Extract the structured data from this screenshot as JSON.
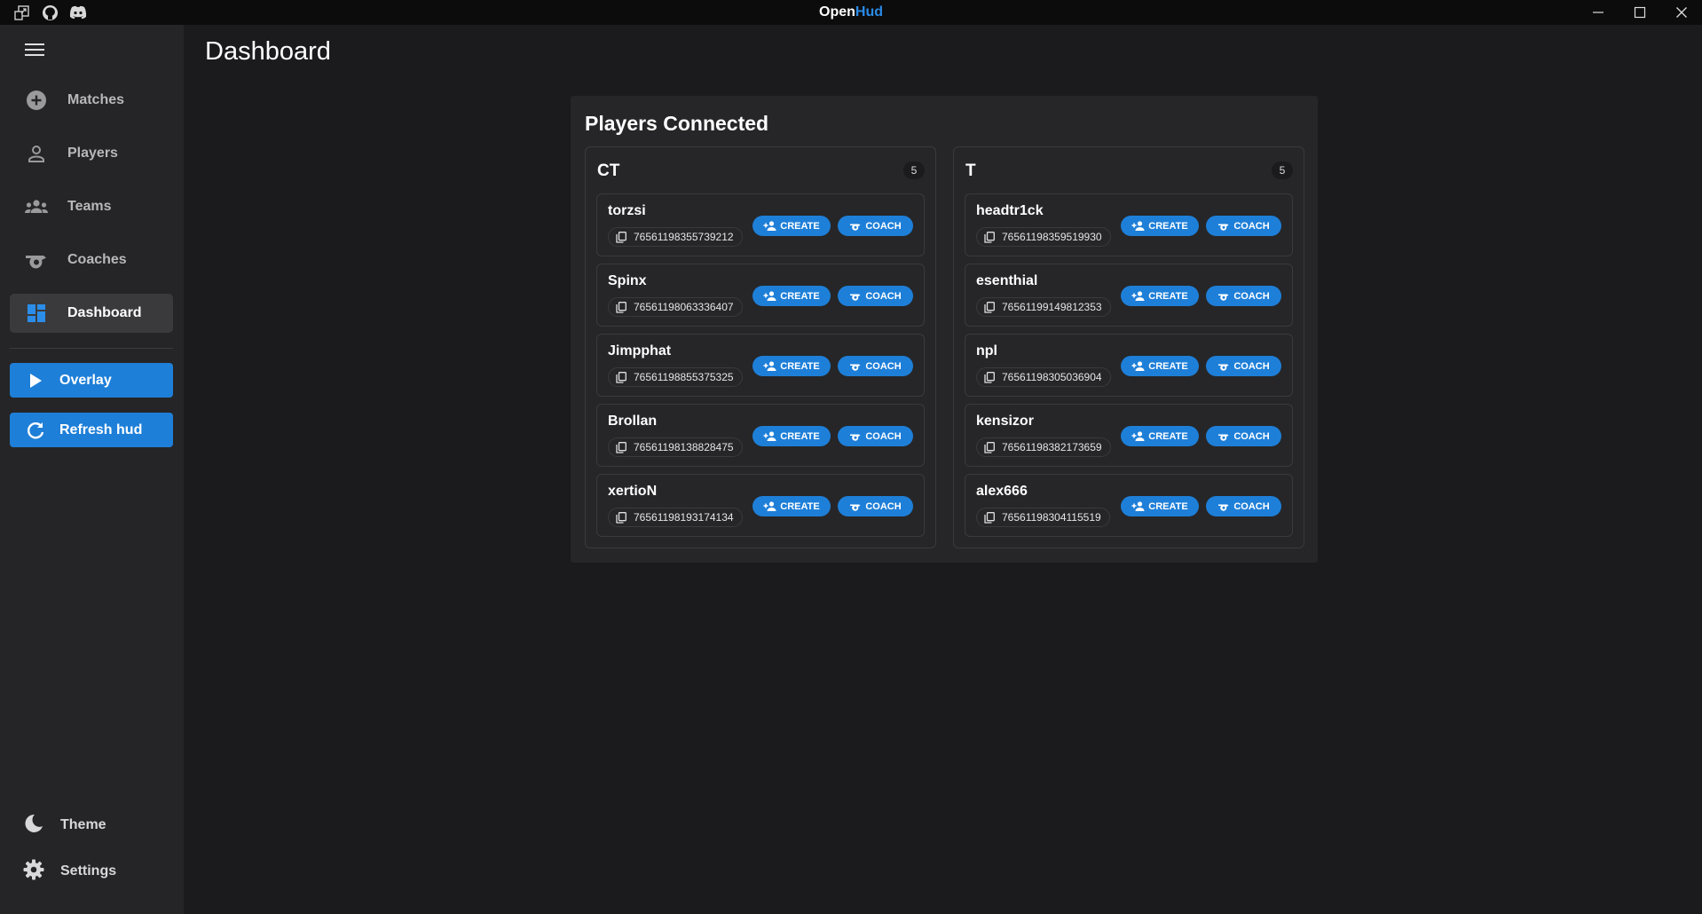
{
  "titlebar": {
    "title_main": "Open",
    "title_accent": "Hud",
    "icons": [
      "external-window-icon",
      "github-icon",
      "discord-icon"
    ],
    "controls": [
      "minimize-icon",
      "maximize-icon",
      "close-icon"
    ]
  },
  "sidebar": {
    "items": [
      {
        "label": "Matches",
        "icon": "plus-circle-icon"
      },
      {
        "label": "Players",
        "icon": "person-icon"
      },
      {
        "label": "Teams",
        "icon": "group-icon"
      },
      {
        "label": "Coaches",
        "icon": "whistle-icon"
      },
      {
        "label": "Dashboard",
        "icon": "dashboard-icon",
        "active": true
      }
    ],
    "overlay_label": "Overlay",
    "refresh_label": "Refresh hud",
    "theme_label": "Theme",
    "settings_label": "Settings"
  },
  "main": {
    "page_title": "Dashboard",
    "panel_title": "Players Connected",
    "create_label": "CREATE",
    "coach_label": "COACH",
    "teams": [
      {
        "name": "CT",
        "count": "5",
        "players": [
          {
            "name": "torzsi",
            "steamid": "76561198355739212"
          },
          {
            "name": "Spinx",
            "steamid": "76561198063336407"
          },
          {
            "name": "Jimpphat",
            "steamid": "76561198855375325"
          },
          {
            "name": "Brollan",
            "steamid": "76561198138828475"
          },
          {
            "name": "xertioN",
            "steamid": "76561198193174134"
          }
        ]
      },
      {
        "name": "T",
        "count": "5",
        "players": [
          {
            "name": "headtr1ck",
            "steamid": "76561198359519930"
          },
          {
            "name": "esenthial",
            "steamid": "76561199149812353"
          },
          {
            "name": "npl",
            "steamid": "76561198305036904"
          },
          {
            "name": "kensizor",
            "steamid": "76561198382173659"
          },
          {
            "name": "alex666",
            "steamid": "76561198304115519"
          }
        ]
      }
    ]
  },
  "colors": {
    "accent": "#1e7fd8",
    "background": "#1b1b1d",
    "sidebar": "#252527",
    "panel": "#262628"
  }
}
